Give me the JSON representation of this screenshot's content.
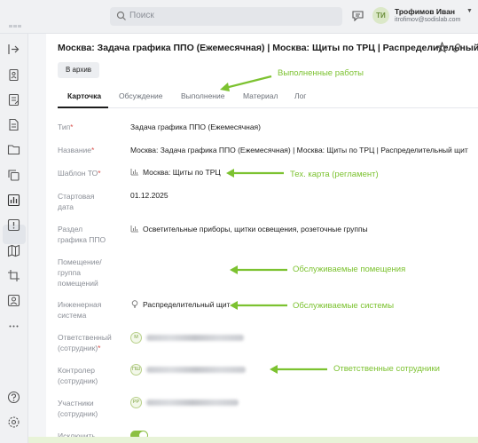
{
  "header": {
    "search_placeholder": "Поиск",
    "user_initials": "ТИ",
    "user_name": "Трофимов Иван",
    "user_email": "itrofimov@sodislab.com"
  },
  "sidebar": {
    "icons": [
      "collapse-icon",
      "contacts-icon",
      "notes-icon",
      "document-icon",
      "folder-icon",
      "copy-icon",
      "chart-icon",
      "alert-icon",
      "map-icon",
      "crop-icon",
      "person-icon",
      "more-icon",
      "help-icon",
      "settings-icon"
    ],
    "active": "chart-icon"
  },
  "page": {
    "title": "Москва: Задача графика ППО (Ежемесячная) | Москва: Щиты по ТРЦ | Распределительный щит",
    "archive_button": "В архив"
  },
  "tabs": [
    {
      "label": "Карточка",
      "active": true
    },
    {
      "label": "Обсуждение",
      "active": false
    },
    {
      "label": "Выполнение",
      "active": false
    },
    {
      "label": "Материал",
      "active": false
    },
    {
      "label": "Лог",
      "active": false
    }
  ],
  "fields": {
    "type": {
      "label": "Тип",
      "required": "*",
      "value": "Задача графика ППО (Ежемесячная)"
    },
    "name": {
      "label": "Название",
      "required": "*",
      "value": "Москва: Задача графика ППО (Ежемесячная) | Москва: Щиты по ТРЦ | Распределительный щит"
    },
    "template": {
      "label": "Шаблон ТО",
      "required": "*",
      "value": "Москва: Щиты по ТРЦ"
    },
    "start_date": {
      "label1": "Стартовая",
      "label2": "дата",
      "value": "01.12.2025"
    },
    "section": {
      "label1": "Раздел",
      "label2": "графика ППО",
      "value": "Осветительные приборы, щитки освещения, розеточные группы"
    },
    "room": {
      "label1": "Помещение/",
      "label2": "группа",
      "label3": "помещений"
    },
    "system": {
      "label1": "Инженерная",
      "label2": "система",
      "value": "Распределительный щит"
    },
    "responsible": {
      "label1": "Ответственный",
      "label2": "(сотрудник)",
      "required": "*",
      "initials": "M"
    },
    "controller": {
      "label1": "Контролер",
      "label2": "(сотрудник)",
      "initials": "ПШ"
    },
    "participants": {
      "label1": "Участники",
      "label2": "(сотрудник)",
      "initials": "РР"
    },
    "exclude": {
      "label": "Исключить",
      "on": true
    }
  },
  "annotations": {
    "works": "Выполненные работы",
    "techcard": "Тех. карта (регламент)",
    "rooms": "Обслуживаемые помещения",
    "systems": "Обслуживаемые системы",
    "staff": "Ответственные сотрудники",
    "color": "#7cc230"
  }
}
